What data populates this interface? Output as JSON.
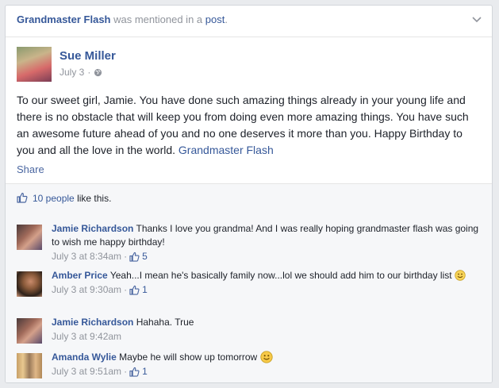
{
  "story": {
    "page_name": "Grandmaster Flash",
    "mention_text": "was mentioned in a",
    "post_link": "post",
    "period": "."
  },
  "post": {
    "author": "Sue Miller",
    "date": "July 3",
    "separator": "·",
    "body": "To our sweet girl, Jamie. You have done such amazing things already in your young life and there is no obstacle that will keep you from doing even more amazing things. You have such an awesome future ahead of you and no one deserves it more than you. Happy Birthday to you and all the love in the world.",
    "mention": "Grandmaster Flash",
    "share_label": "Share"
  },
  "likes": {
    "count_label": "10 people",
    "suffix": "like this."
  },
  "comments": [
    {
      "name": "Jamie Richardson",
      "text": "Thanks I love you grandma! And I was really hoping grandmaster flash was going to wish me happy birthday!",
      "time": "July 3 at 8:34am",
      "likes": "5"
    },
    {
      "name": "Amber Price",
      "text": "Yeah...I mean he's basically family now...lol we should add him to our birthday list",
      "time": "July 3 at 9:30am",
      "likes": "1"
    },
    {
      "name": "Jamie Richardson",
      "text": "Hahaha. True",
      "time": "July 3 at 9:42am",
      "likes": ""
    },
    {
      "name": "Amanda Wylie",
      "text": "Maybe he will show up tomorrow",
      "time": "July 3 at 9:51am",
      "likes": "1"
    }
  ],
  "meta_separator": "·",
  "icons": {
    "chevron": "chevron-down-icon",
    "globe": "globe-icon",
    "thumb": "thumbs-up-icon",
    "smiley": "smiley-emoji-icon"
  },
  "colors": {
    "link": "#365899",
    "muted": "#90949c",
    "text": "#1d2129",
    "background": "#e9ebee"
  }
}
